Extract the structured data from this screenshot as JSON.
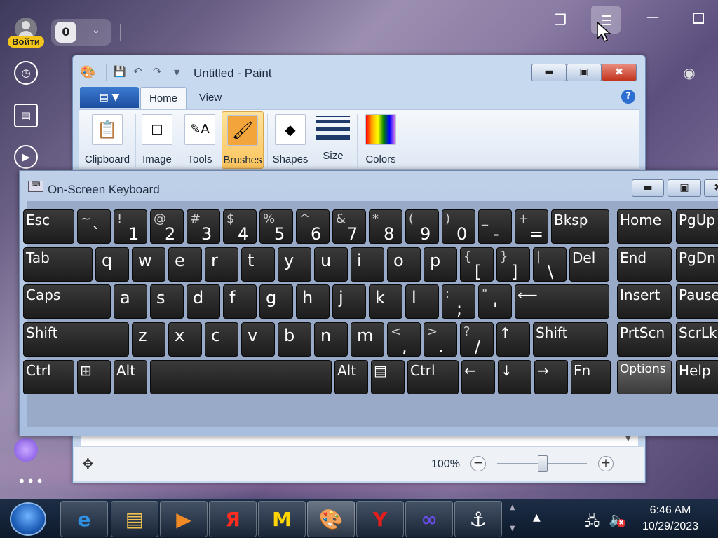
{
  "browser": {
    "login_label": "Войти",
    "tab_count": "0"
  },
  "paint": {
    "title": "Untitled - Paint",
    "tabs": [
      "Home",
      "View"
    ],
    "groups": [
      "Clipboard",
      "Image",
      "Tools",
      "Brushes",
      "Shapes",
      "Size",
      "Colors"
    ],
    "zoom": "100%"
  },
  "osk": {
    "title": "On-Screen Keyboard",
    "rows": [
      [
        {
          "l": "Esc"
        },
        {
          "t": "~",
          "b": "`"
        },
        {
          "t": "!",
          "b": "1"
        },
        {
          "t": "@",
          "b": "2"
        },
        {
          "t": "#",
          "b": "3"
        },
        {
          "t": "$",
          "b": "4"
        },
        {
          "t": "%",
          "b": "5"
        },
        {
          "t": "^",
          "b": "6"
        },
        {
          "t": "&",
          "b": "7"
        },
        {
          "t": "*",
          "b": "8"
        },
        {
          "t": "(",
          "b": "9"
        },
        {
          "t": ")",
          "b": "0"
        },
        {
          "t": "_",
          "b": "-"
        },
        {
          "t": "+",
          "b": "="
        },
        {
          "l": "Bksp"
        },
        {
          "l": "Home"
        },
        {
          "l": "PgUp"
        }
      ],
      [
        {
          "l": "Tab"
        },
        {
          "m": "q"
        },
        {
          "m": "w"
        },
        {
          "m": "e"
        },
        {
          "m": "r"
        },
        {
          "m": "t"
        },
        {
          "m": "y"
        },
        {
          "m": "u"
        },
        {
          "m": "i"
        },
        {
          "m": "o"
        },
        {
          "m": "p"
        },
        {
          "t": "{",
          "b": "["
        },
        {
          "t": "}",
          "b": "]"
        },
        {
          "t": "|",
          "b": "\\"
        },
        {
          "l": "Del"
        },
        {
          "l": "End"
        },
        {
          "l": "PgDn"
        }
      ],
      [
        {
          "l": "Caps"
        },
        {
          "m": "a"
        },
        {
          "m": "s"
        },
        {
          "m": "d"
        },
        {
          "m": "f"
        },
        {
          "m": "g"
        },
        {
          "m": "h"
        },
        {
          "m": "j"
        },
        {
          "m": "k"
        },
        {
          "m": "l"
        },
        {
          "t": ":",
          "b": ";"
        },
        {
          "t": "\"",
          "b": "'"
        },
        {
          "l": "⟵"
        },
        {
          "l": "Insert"
        },
        {
          "l": "Pause"
        }
      ],
      [
        {
          "l": "Shift"
        },
        {
          "m": "z"
        },
        {
          "m": "x"
        },
        {
          "m": "c"
        },
        {
          "m": "v"
        },
        {
          "m": "b"
        },
        {
          "m": "n"
        },
        {
          "m": "m"
        },
        {
          "t": "<",
          "b": ","
        },
        {
          "t": ">",
          "b": "."
        },
        {
          "t": "?",
          "b": "/"
        },
        {
          "l": "↑"
        },
        {
          "l": "Shift"
        },
        {
          "l": "PrtScn"
        },
        {
          "l": "ScrLk"
        }
      ],
      [
        {
          "l": "Ctrl"
        },
        {
          "l": "⊞"
        },
        {
          "l": "Alt"
        },
        {
          "l": ""
        },
        {
          "l": "Alt"
        },
        {
          "l": "▤"
        },
        {
          "l": "Ctrl"
        },
        {
          "l": "←"
        },
        {
          "l": "↓"
        },
        {
          "l": "→"
        },
        {
          "l": "Fn"
        },
        {
          "l": "Options"
        },
        {
          "l": "Help"
        }
      ]
    ]
  },
  "taskbar": {
    "time": "6:46 AM",
    "date": "10/29/2023",
    "apps": [
      {
        "name": "internet-explorer",
        "glyph": "e",
        "color": "#2f8fe0"
      },
      {
        "name": "file-explorer",
        "glyph": "▤",
        "color": "#f2c14e"
      },
      {
        "name": "media-player",
        "glyph": "▶",
        "color": "#f08a24"
      },
      {
        "name": "yandex",
        "glyph": "Я",
        "color": "#ff2d1e"
      },
      {
        "name": "yandex-market",
        "glyph": "M",
        "color": "#ffd400"
      },
      {
        "name": "paint",
        "glyph": "🎨",
        "color": "#ffffff"
      },
      {
        "name": "yandex-browser",
        "glyph": "Y",
        "color": "#e41e1e"
      },
      {
        "name": "infinity-app",
        "glyph": "∞",
        "color": "#6b4cf0"
      },
      {
        "name": "world-of-warships",
        "glyph": "⚓",
        "color": "#ffffff"
      }
    ]
  }
}
